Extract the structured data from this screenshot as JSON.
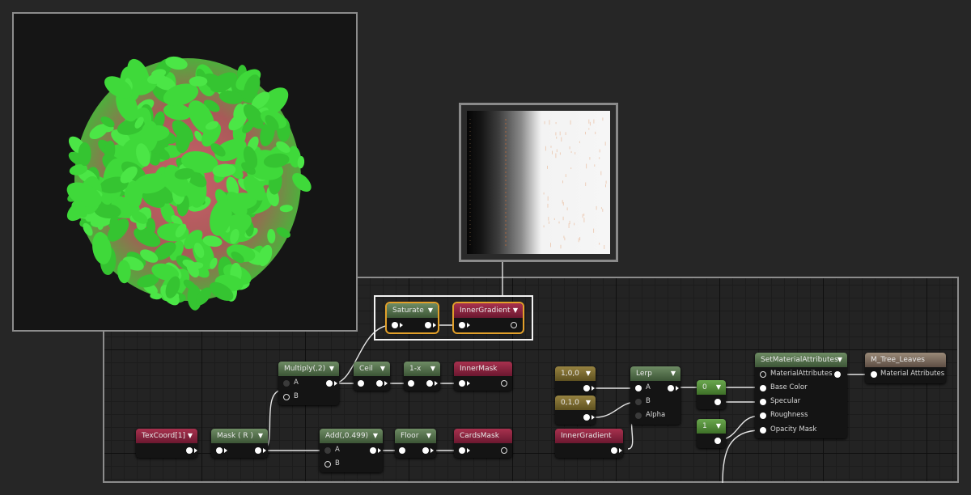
{
  "viewport": {
    "label": "3D preview viewport"
  },
  "preview": {
    "label": "InnerGradient texture preview"
  },
  "nodes": {
    "texcoord": {
      "title": "TexCoord[1]"
    },
    "mask": {
      "title": "Mask ( R )"
    },
    "multiply": {
      "title": "Multiply(,2)",
      "pin_a": "A",
      "pin_b": "B"
    },
    "ceil": {
      "title": "Ceil"
    },
    "oneminus": {
      "title": "1-x"
    },
    "innermask": {
      "title": "InnerMask"
    },
    "add": {
      "title": "Add(,0.499)",
      "pin_a": "A",
      "pin_b": "B"
    },
    "floor": {
      "title": "Floor"
    },
    "cardsmask": {
      "title": "CardsMask"
    },
    "saturate": {
      "title": "Saturate"
    },
    "innergradient_top": {
      "title": "InnerGradient"
    },
    "const100": {
      "title": "1,0,0"
    },
    "const010": {
      "title": "0,1,0"
    },
    "innergradient_bottom": {
      "title": "InnerGradient"
    },
    "lerp": {
      "title": "Lerp",
      "pin_a": "A",
      "pin_b": "B",
      "pin_alpha": "Alpha"
    },
    "const0": {
      "title": "0"
    },
    "const1": {
      "title": "1"
    },
    "setmaterial": {
      "title": "SetMaterialAttributes",
      "pins": [
        "MaterialAttributes",
        "Base Color",
        "Specular",
        "Roughness",
        "Opacity Mask"
      ]
    },
    "result": {
      "title": "M_Tree_Leaves",
      "pin": "Material Attributes"
    }
  },
  "colors": {
    "accent_selected": "#e2a02a",
    "leaf_green": "#3fd93a",
    "leaf_red": "#c0585a"
  }
}
